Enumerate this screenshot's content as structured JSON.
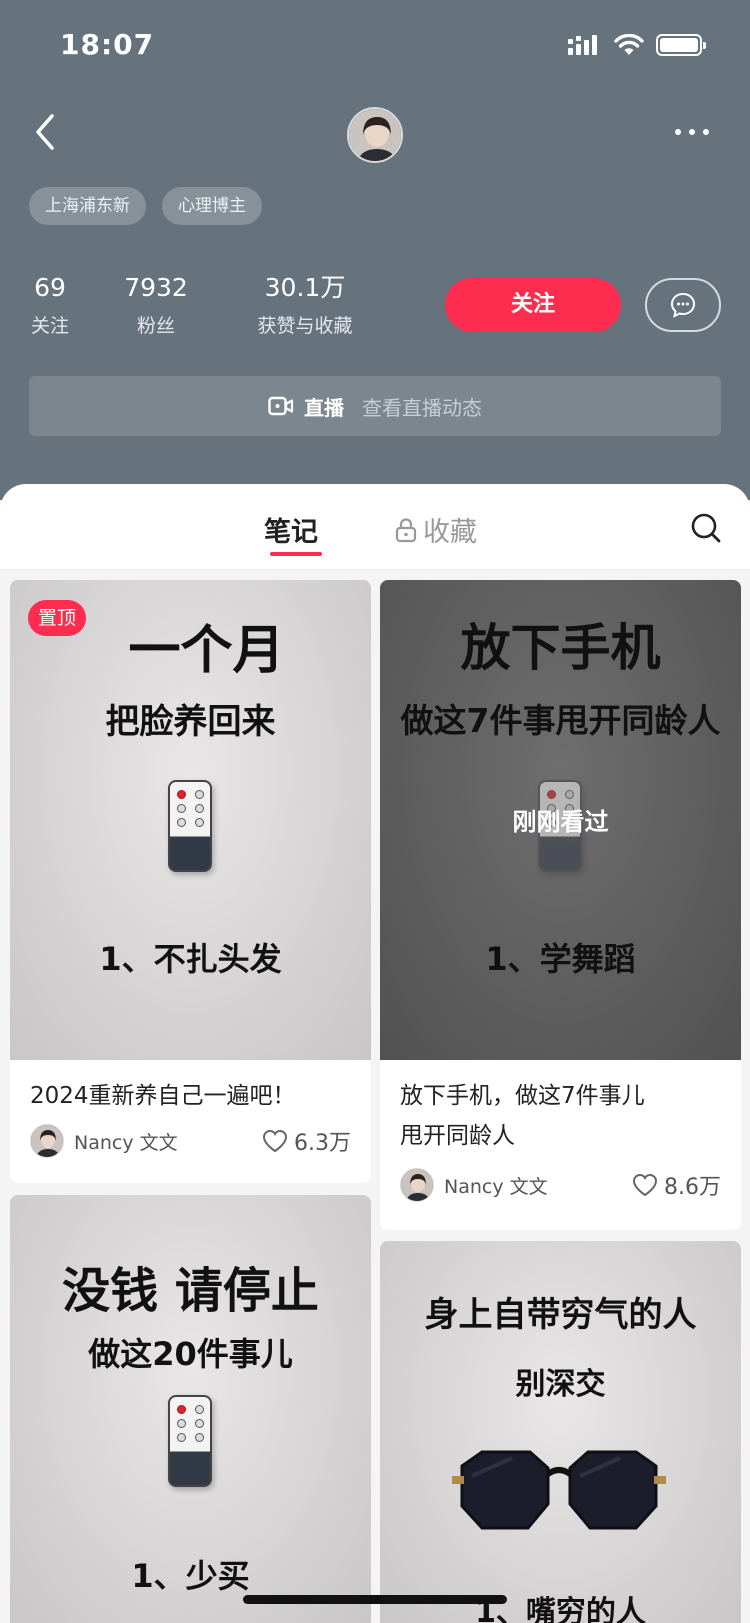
{
  "status_bar": {
    "time": "18:07"
  },
  "profile": {
    "tags": [
      "上海浦东新",
      "心理博主"
    ],
    "stats": [
      {
        "num": "69",
        "label": "关注"
      },
      {
        "num": "7932",
        "label": "粉丝"
      },
      {
        "num": "30.1万",
        "label": "获赞与收藏"
      }
    ],
    "follow_label": "关注",
    "live_label": "直播",
    "live_sub": "查看直播动态"
  },
  "tabs": {
    "notes": "笔记",
    "collect": "收藏"
  },
  "colors": {
    "header_bg": "#66737d",
    "accent": "#fe2c4f"
  },
  "notes": [
    {
      "pinned_label": "置顶",
      "cover_title": "一个月",
      "cover_subtitle": "把脸养回来",
      "cover_point": "1、不扎头发",
      "title": "2024重新养自己一遍吧！",
      "author": "Nancy 文文",
      "likes": "6.3万"
    },
    {
      "viewed_label": "刚刚看过",
      "cover_title": "放下手机",
      "cover_subtitle": "做这7件事甩开同龄人",
      "cover_point": "1、学舞蹈",
      "title_line1": "放下手机，做这7件事儿",
      "title_line2": "甩开同龄人",
      "author": "Nancy 文文",
      "likes": "8.6万"
    },
    {
      "cover_title": "没钱 请停止",
      "cover_subtitle": "做这20件事儿",
      "cover_point": "1、少买"
    },
    {
      "cover_title": "身上自带穷气的人",
      "cover_subtitle": "别深交",
      "cover_point": "1、嘴穷的人"
    }
  ]
}
